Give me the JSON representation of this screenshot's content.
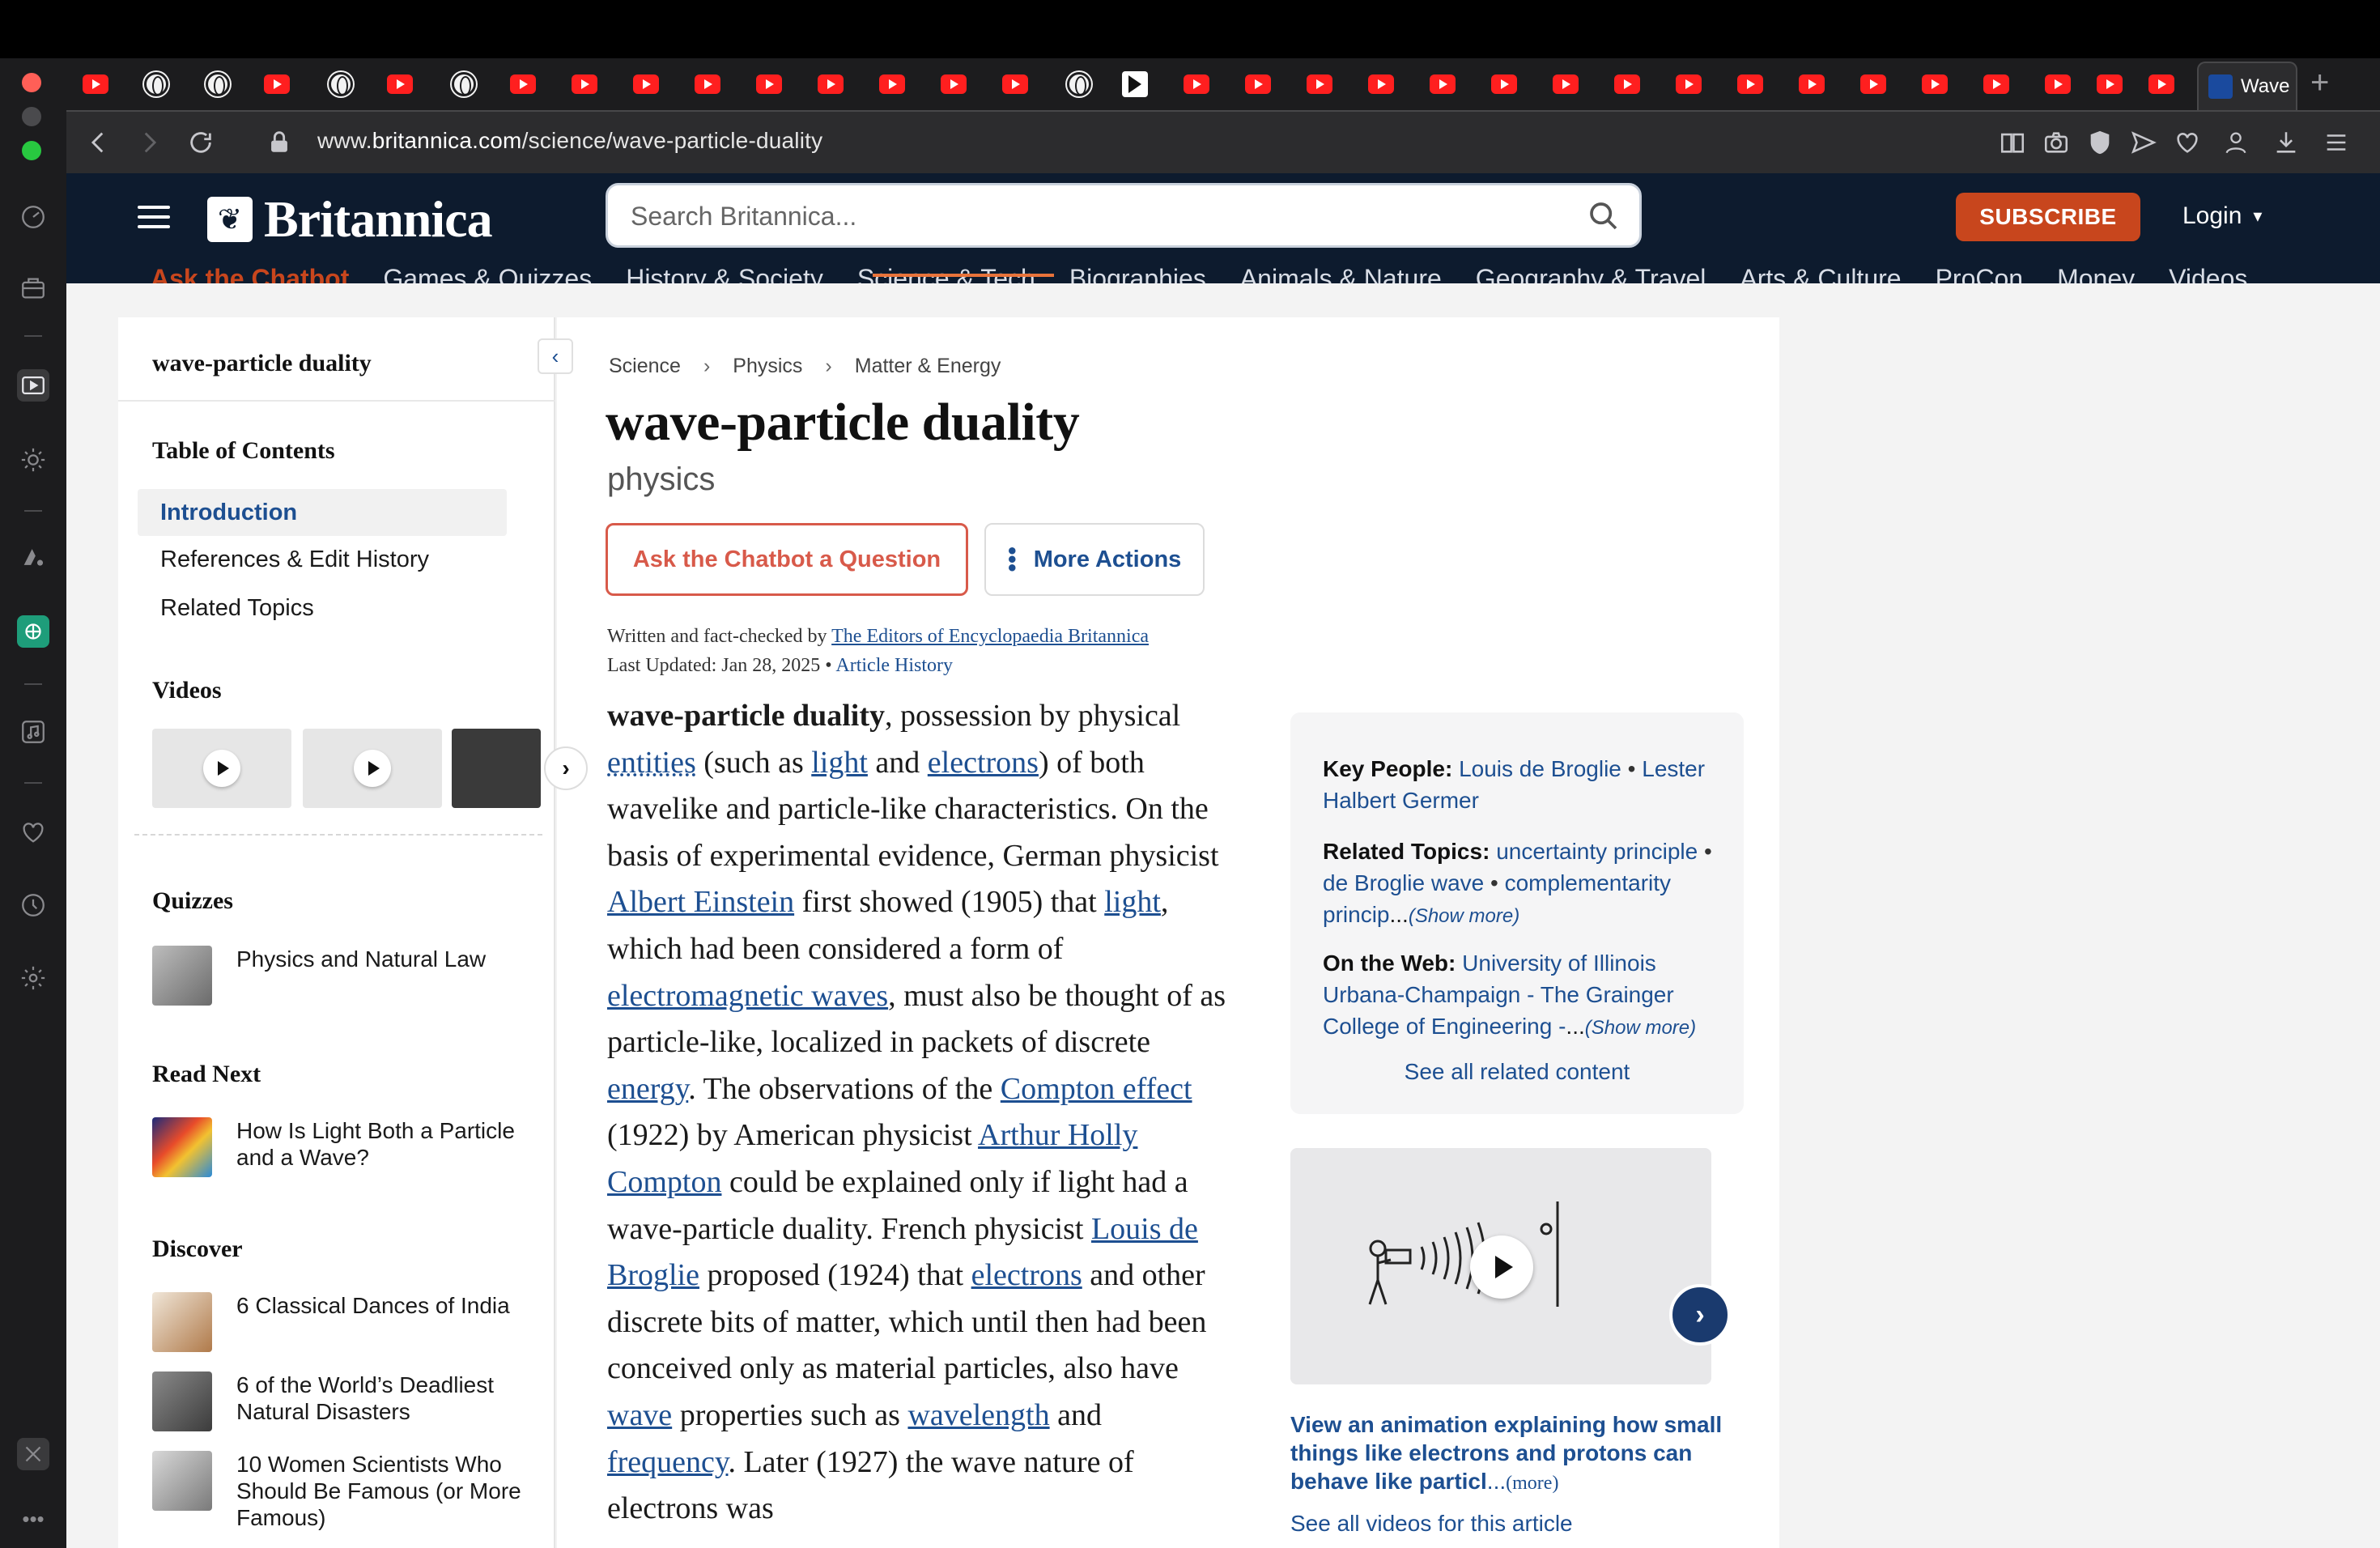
{
  "browser": {
    "url_prefix": "www.",
    "url_domain": "britannica.com",
    "url_path": "/science/wave-particle-duality",
    "active_tab_title": "Wave",
    "new_tab_label": "+"
  },
  "site": {
    "logo_text": "Britannica",
    "search_placeholder": "Search Britannica...",
    "subscribe_label": "SUBSCRIBE",
    "login_label": "Login",
    "nav": [
      "Ask the Chatbot",
      "Games & Quizzes",
      "History & Society",
      "Science & Tech",
      "Biographies",
      "Animals & Nature",
      "Geography & Travel",
      "Arts & Culture",
      "ProCon",
      "Money",
      "Videos"
    ]
  },
  "left": {
    "header": "wave-particle duality",
    "toc_title": "Table of Contents",
    "toc": [
      "Introduction",
      "References & Edit History",
      "Related Topics"
    ],
    "videos_title": "Videos",
    "quizzes_title": "Quizzes",
    "quiz_item": "Physics and Natural Law",
    "read_next_title": "Read Next",
    "read_next_item": "How Is Light Both a Particle and a Wave?",
    "discover_title": "Discover",
    "discover": [
      "6 Classical Dances of India",
      "6 of the World’s Deadliest Natural Disasters",
      "10 Women Scientists Who Should Be Famous (or More Famous)"
    ]
  },
  "article": {
    "breadcrumbs": [
      "Science",
      "Physics",
      "Matter & Energy"
    ],
    "title": "wave-particle duality",
    "subtitle": "physics",
    "chatbot_button": "Ask the Chatbot a Question",
    "more_actions_button": "More Actions",
    "byline_prefix": "Written and fact-checked by",
    "byline_author": "The Editors of Encyclopaedia Britannica",
    "updated_prefix": "Last Updated: Jan 28, 2025 •",
    "article_history": "Article History",
    "body": {
      "term": "wave-particle duality",
      "t1": ", possession by physical ",
      "l1": "entities",
      "t2": " (such as ",
      "l2": "light",
      "t3": " and ",
      "l3": "electrons",
      "t4": ") of both wavelike and particle-like characteristics. On the basis of experimental evidence, German physicist ",
      "l4": "Albert Einstein",
      "t5": " first showed (1905) that ",
      "l5": "light",
      "t6": ", which had been considered a form of ",
      "l6": "electromagnetic waves",
      "t7": ", must also be thought of as particle-like, localized in packets of discrete ",
      "l7": "energy",
      "t8": ". The observations of the ",
      "l8": "Compton effect",
      "t9": " (1922) by American physicist ",
      "l9": "Arthur Holly Compton",
      "t10": " could be explained only if light had a wave-particle duality. French physicist ",
      "l10": "Louis de Broglie",
      "t11": " proposed (1924) that ",
      "l11": "electrons",
      "t12": " and other discrete bits of matter, which until then had been conceived only as material particles, also have ",
      "l12": "wave",
      "t13": " properties such as ",
      "l13": "wavelength",
      "t14": " and ",
      "l14": "frequency",
      "t15": ". Later (1927) the wave nature of electrons was"
    }
  },
  "facts": {
    "key_people_label": "Key People:",
    "key_people_1": "Louis de Broglie",
    "key_people_2": "Lester Halbert Germer",
    "related_label": "Related Topics:",
    "related_1": "uncertainty principle",
    "related_2": "de Broglie wave",
    "related_3": "complementarity princip",
    "show_more": "(Show more)",
    "web_label": "On the Web:",
    "web_1": "University of Illinois Urbana-Champaign - The Grainger College of Engineering -",
    "see_all_related": "See all related content",
    "separator": "•",
    "ellipsis": "..."
  },
  "video": {
    "caption": "View an animation explaining how small things like electrons and protons can behave like particl",
    "caption_more": "(more)",
    "see_all_videos": "See all videos for this article"
  }
}
